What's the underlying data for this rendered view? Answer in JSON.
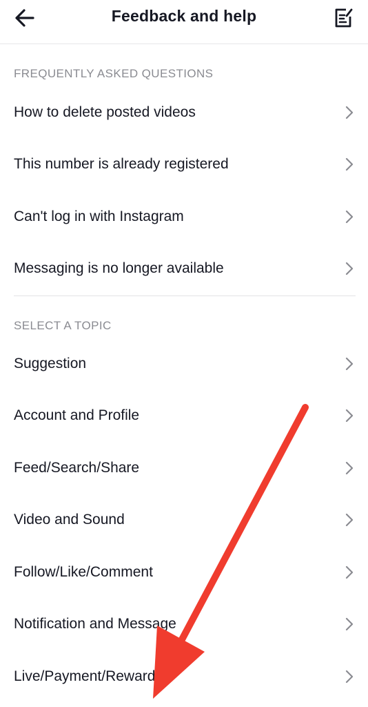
{
  "header": {
    "title": "Feedback and help",
    "back_icon": "arrow-left-icon",
    "report_icon": "edit-report-icon"
  },
  "faq": {
    "section_title": "FREQUENTLY ASKED QUESTIONS",
    "items": [
      {
        "label": "How to delete posted videos"
      },
      {
        "label": "This number is already registered"
      },
      {
        "label": "Can't log in with Instagram"
      },
      {
        "label": "Messaging is no longer available"
      }
    ]
  },
  "topics": {
    "section_title": "SELECT A TOPIC",
    "items": [
      {
        "label": "Suggestion"
      },
      {
        "label": "Account and Profile"
      },
      {
        "label": "Feed/Search/Share"
      },
      {
        "label": "Video and Sound"
      },
      {
        "label": "Follow/Like/Comment"
      },
      {
        "label": "Notification and Message"
      },
      {
        "label": "Live/Payment/Rewards"
      }
    ]
  },
  "annotation": {
    "arrow_color": "#f03c2e"
  },
  "colors": {
    "text": "#161823",
    "muted": "#8a8b91",
    "divider": "#e3e3e5"
  }
}
